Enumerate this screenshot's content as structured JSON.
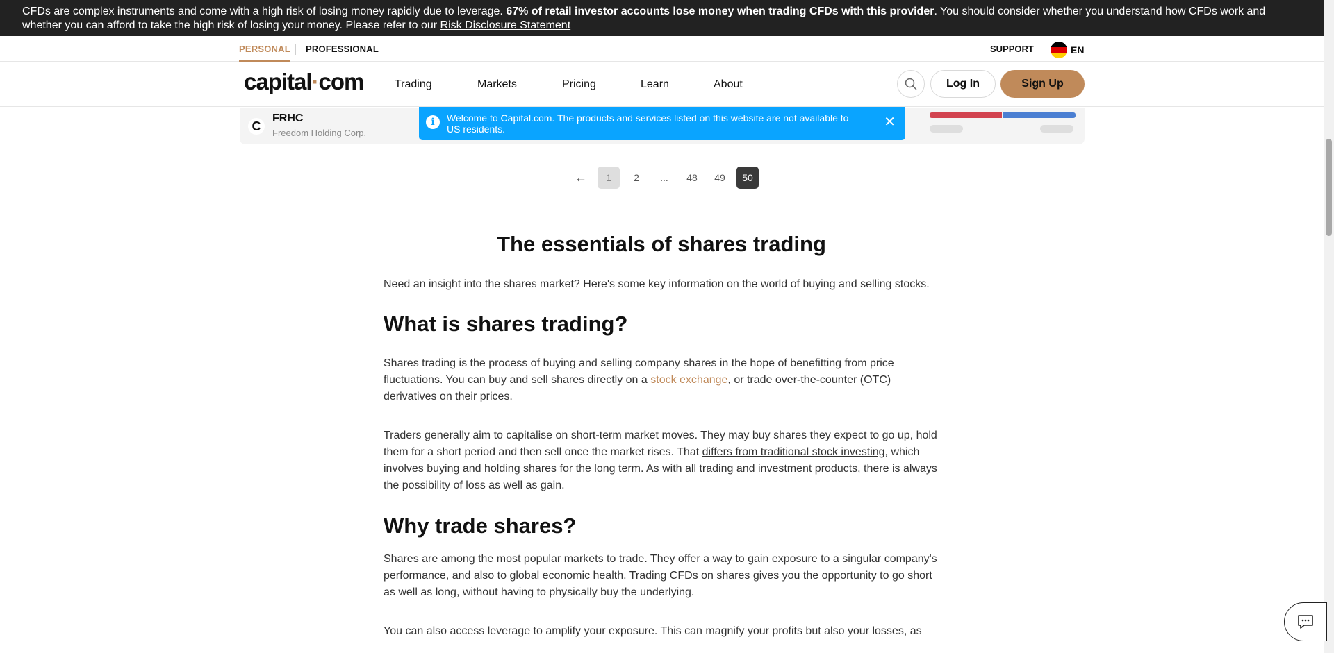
{
  "risk_banner": {
    "text_before": "CFDs are complex instruments and come with a high risk of losing money rapidly due to leverage. ",
    "bold": "67% of retail investor accounts lose money when trading CFDs with this provider",
    "text_after": ". You should consider whether you understand how CFDs work and whether you can afford to take the high risk of losing your money. Please refer to our ",
    "link": "Risk Disclosure Statement"
  },
  "topbar": {
    "personal": "PERSONAL",
    "professional": "PROFESSIONAL",
    "support": "SUPPORT",
    "language": "EN"
  },
  "nav": {
    "logo_left": "capital",
    "logo_dot": "·",
    "logo_right": "com",
    "items": [
      "Trading",
      "Markets",
      "Pricing",
      "Learn",
      "About"
    ],
    "login": "Log In",
    "signup": "Sign Up"
  },
  "market_row": {
    "logo_letter": "C",
    "symbol": "FRHC",
    "name": "Freedom Holding Corp."
  },
  "notice": {
    "icon": "i",
    "text": "Welcome to Capital.com. The products and services listed on this website are not available to US residents.",
    "close": "✕"
  },
  "pagination": {
    "prev": "←",
    "pages": [
      "1",
      "2",
      "...",
      "48",
      "49",
      "50"
    ]
  },
  "article": {
    "title": "The essentials of shares trading",
    "intro": "Need an insight into the shares market? Here's some key information on the world of buying and selling stocks.",
    "h2_1": "What is shares trading?",
    "p1_before": "Shares trading is the process of buying and selling company shares in the hope of benefitting from price fluctuations. You can buy and sell shares directly on a",
    "p1_link": " stock exchange",
    "p1_after": ", or trade over-the-counter (OTC) derivatives on their prices.",
    "p2_before": "Traders generally aim to capitalise on short-term market moves. They may buy shares they expect to go up, hold them for a short period and then sell once the market rises. That ",
    "p2_link": "differs from traditional stock investing",
    "p2_after": ", which involves buying and holding shares for the long term. As with all trading and investment products, there is always the possibility of loss as well as gain.",
    "h2_2": "Why trade shares?",
    "p3_before": "Shares are among ",
    "p3_link": "the most popular markets to trade",
    "p3_after": ". They offer a way to gain exposure to a singular company's performance, and also to global economic health. Trading CFDs on shares gives you the opportunity to go short as well as long, without having to physically buy the underlying.",
    "p4": "You can also access leverage to amplify your exposure. This can magnify your profits but also your losses, as"
  },
  "colors": {
    "accent": "#c08a5a",
    "banner_bg": "#222222",
    "notice_bg": "#0aa4ff",
    "bar_red": "#d2434f",
    "bar_blue": "#4b7fd2"
  },
  "icons": {
    "search": "search-icon",
    "chat": "chat-icon",
    "flag": "germany-flag-icon",
    "info": "info-icon",
    "close": "close-icon"
  }
}
